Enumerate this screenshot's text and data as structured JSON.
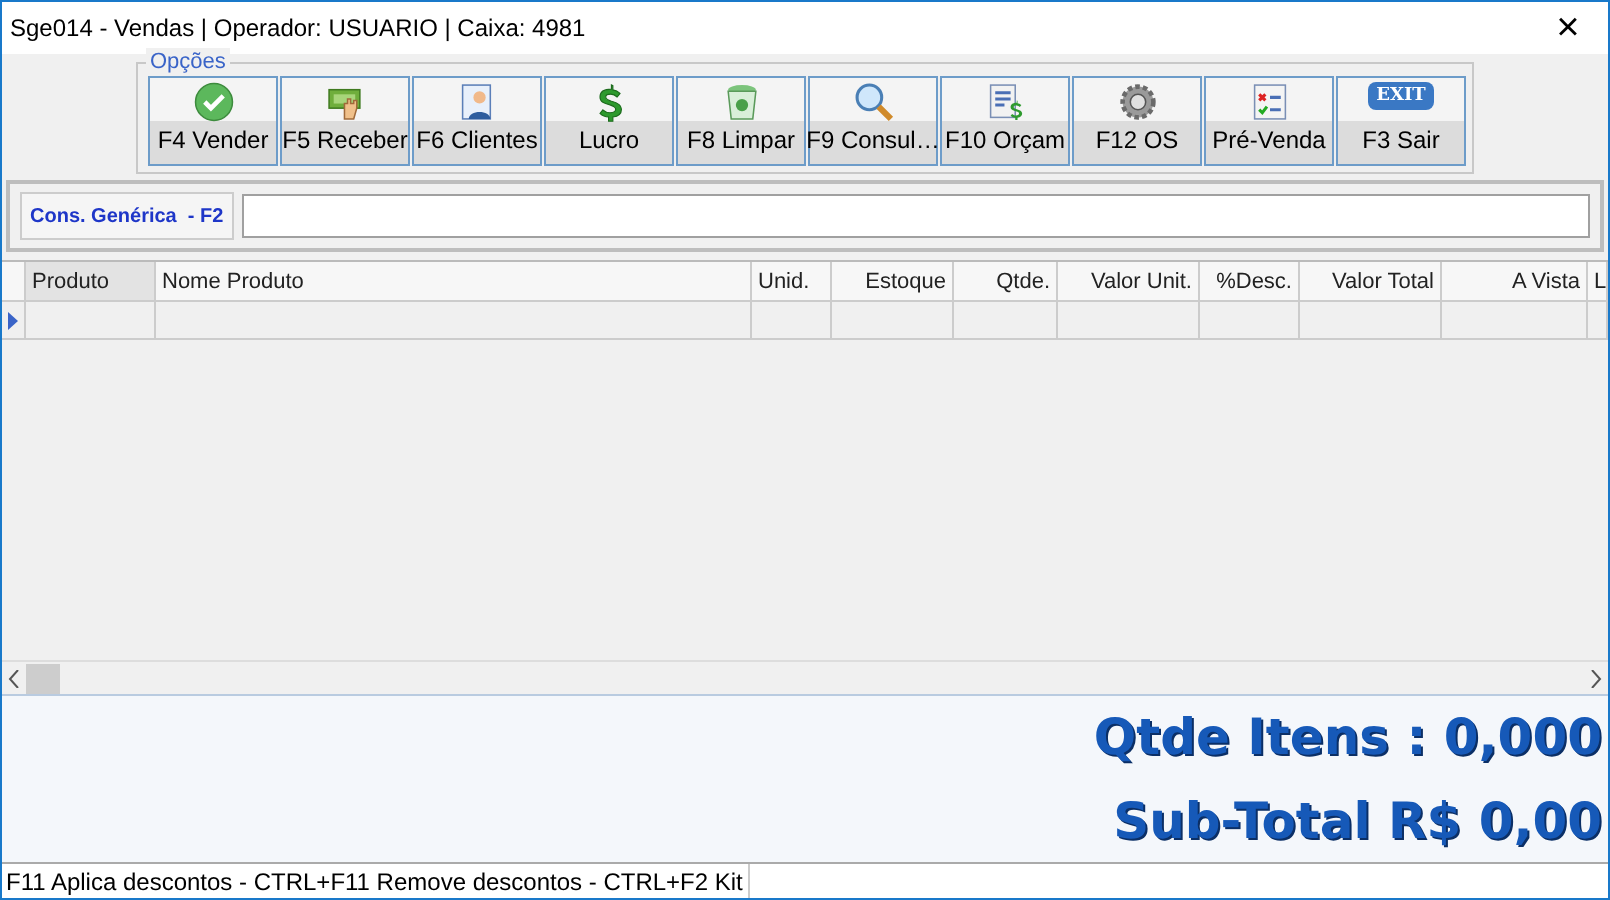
{
  "window": {
    "title": "Sge014 - Vendas | Operador: USUARIO | Caixa: 4981",
    "close": "×"
  },
  "toolbar": {
    "legend": "Opções",
    "buttons": [
      {
        "label": "F4 Vender",
        "kind": "check"
      },
      {
        "label": "F5 Receber",
        "kind": "money"
      },
      {
        "label": "F6 Clientes",
        "kind": "person"
      },
      {
        "label": "Lucro",
        "kind": "dollar"
      },
      {
        "label": "F8 Limpar",
        "kind": "trash"
      },
      {
        "label": "F9 Consul…",
        "kind": "search"
      },
      {
        "label": "F10 Orçam",
        "kind": "list"
      },
      {
        "label": "F12 OS",
        "kind": "gear"
      },
      {
        "label": "Pré-Venda",
        "kind": "checklist"
      },
      {
        "label": "F3 Sair",
        "kind": "exit",
        "icon_text": "EXIT"
      }
    ]
  },
  "search": {
    "label": "Cons. Genérica  - F2"
  },
  "table": {
    "columns": [
      {
        "label": "Produto"
      },
      {
        "label": "Nome Produto"
      },
      {
        "label": "Unid."
      },
      {
        "label": "Estoque"
      },
      {
        "label": "Qtde."
      },
      {
        "label": "Valor Unit."
      },
      {
        "label": "%Desc."
      },
      {
        "label": "Valor Total"
      },
      {
        "label": "A Vista"
      },
      {
        "label": "L"
      }
    ]
  },
  "totals": {
    "items": "Qtde Itens : 0,000",
    "subtotal": "Sub-Total R$ 0,00"
  },
  "status_bar": "F11 Aplica descontos - CTRL+F11 Remove descontos - CTRL+F2 Kit"
}
